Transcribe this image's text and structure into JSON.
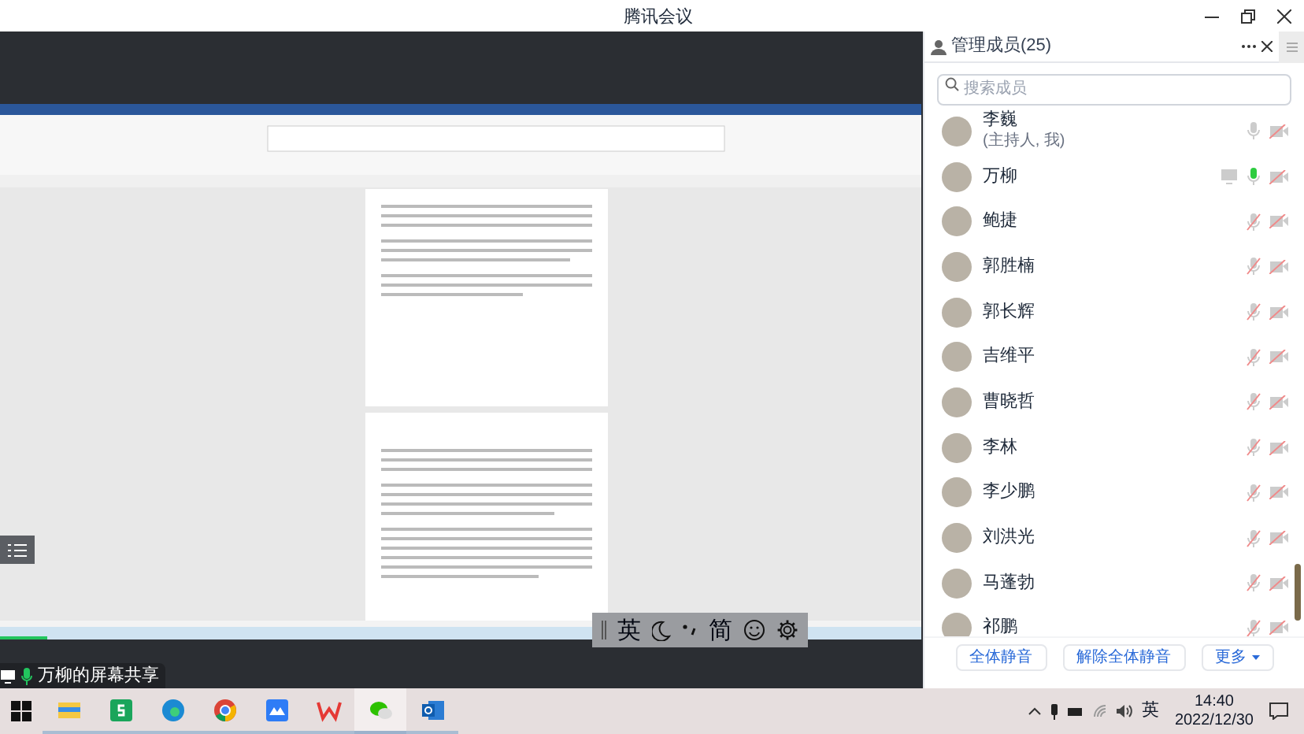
{
  "window": {
    "title": "腾讯会议"
  },
  "screen_share": {
    "label": "万柳的屏幕共享"
  },
  "ime_toolbar": {
    "items": [
      {
        "kind": "text",
        "label": "英"
      },
      {
        "kind": "moon"
      },
      {
        "kind": "punct"
      },
      {
        "kind": "text",
        "label": "简"
      },
      {
        "kind": "smile"
      },
      {
        "kind": "gear"
      }
    ]
  },
  "members_panel": {
    "title": "管理成员(25)",
    "search": {
      "placeholder": "搜索成员"
    },
    "members": [
      {
        "name": "李巍",
        "role": "(主持人, 我)",
        "mic_muted": false,
        "speaking": false,
        "sharing": false
      },
      {
        "name": "万柳",
        "mic_muted": false,
        "speaking": true,
        "sharing": true
      },
      {
        "name": "鲍捷",
        "mic_muted": true,
        "speaking": false,
        "sharing": false
      },
      {
        "name": "郭胜楠",
        "mic_muted": true,
        "speaking": false,
        "sharing": false
      },
      {
        "name": "郭长辉",
        "mic_muted": true,
        "speaking": false,
        "sharing": false
      },
      {
        "name": "吉维平",
        "mic_muted": true,
        "speaking": false,
        "sharing": false
      },
      {
        "name": "曹晓哲",
        "mic_muted": true,
        "speaking": false,
        "sharing": false
      },
      {
        "name": "李林",
        "mic_muted": true,
        "speaking": false,
        "sharing": false
      },
      {
        "name": "李少鹏",
        "mic_muted": true,
        "speaking": false,
        "sharing": false
      },
      {
        "name": "刘洪光",
        "mic_muted": true,
        "speaking": false,
        "sharing": false
      },
      {
        "name": "马蓬勃",
        "mic_muted": true,
        "speaking": false,
        "sharing": false
      },
      {
        "name": "祁鹏",
        "mic_muted": true,
        "speaking": false,
        "sharing": false
      }
    ],
    "buttons": [
      {
        "label": "全体静音",
        "dropdown": false
      },
      {
        "label": "解除全体静音",
        "dropdown": false
      },
      {
        "label": "更多",
        "dropdown": true
      }
    ]
  },
  "taskbar": {
    "apps": [
      {
        "kind": "folder",
        "active": false
      },
      {
        "kind": "sheet",
        "active": false
      },
      {
        "kind": "edge",
        "active": false
      },
      {
        "kind": "chrome",
        "active": false
      },
      {
        "kind": "cloud",
        "active": false
      },
      {
        "kind": "wps",
        "active": false
      },
      {
        "kind": "chat",
        "active": true
      },
      {
        "kind": "mail",
        "active": false
      }
    ],
    "tray": {
      "ime": "英",
      "time": "14:40",
      "date": "2022/12/30"
    }
  }
}
